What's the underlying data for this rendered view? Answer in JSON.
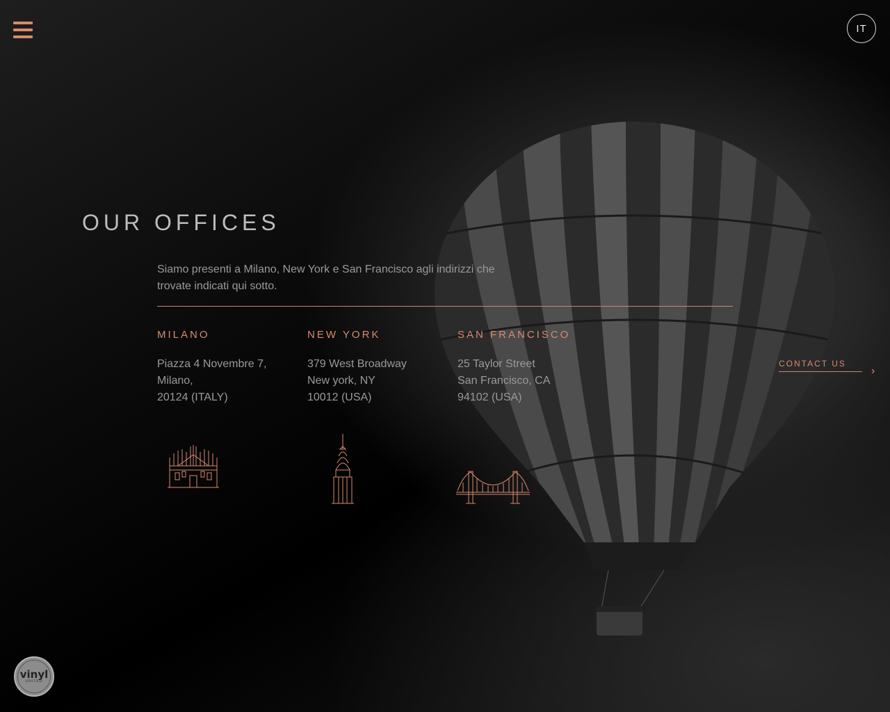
{
  "nav": {
    "menu_icon": "hamburger-icon",
    "language": "IT"
  },
  "section": {
    "title": "OUR OFFICES",
    "intro": "Siamo presenti a Milano, New York e San Francisco agli indirizzi che trovate indicati qui sotto."
  },
  "offices": [
    {
      "name": "MILANO",
      "lines": [
        "Piazza 4 Novembre 7,",
        "Milano,",
        "20124 (ITALY)"
      ],
      "icon": "duomo-cathedral-icon"
    },
    {
      "name": "NEW YORK",
      "lines": [
        "379 West Broadway",
        "New york, NY",
        "10012 (USA)"
      ],
      "icon": "chrysler-building-icon"
    },
    {
      "name": "SAN FRANCISCO",
      "lines": [
        "25 Taylor Street",
        "San Francisco, CA",
        "94102 (USA)"
      ],
      "icon": "golden-gate-bridge-icon"
    }
  ],
  "contact": {
    "label": "CONTACT US",
    "icon": "chevron-right-icon"
  },
  "logo": {
    "main": "vinyl",
    "sub": "UNITED"
  },
  "colors": {
    "accent": "#d98a6e",
    "text": "#9a9a9a",
    "title": "#bdbdbd",
    "background": "#000000"
  }
}
